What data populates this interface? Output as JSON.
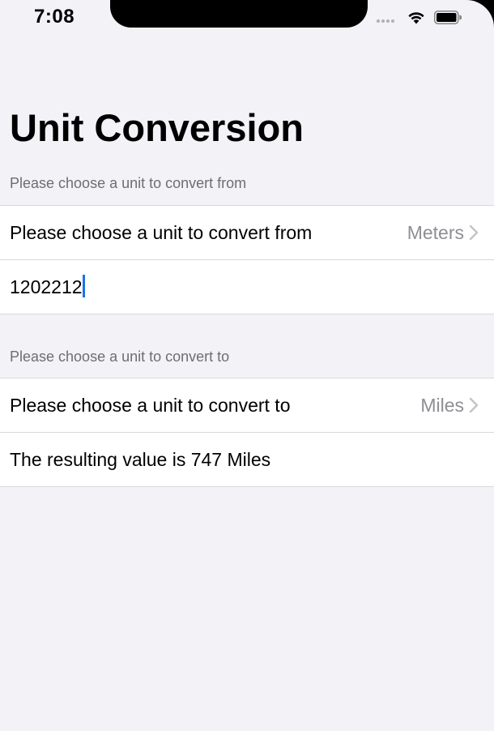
{
  "status_bar": {
    "time": "7:08"
  },
  "page": {
    "title": "Unit Conversion"
  },
  "from_section": {
    "header": "Please choose a unit to convert from",
    "picker_label": "Please choose a unit to convert from",
    "picker_value": "Meters",
    "input_value": "1202212"
  },
  "to_section": {
    "header": "Please choose a unit to convert to",
    "picker_label": "Please choose a unit to convert to",
    "picker_value": "Miles",
    "result_text": "The resulting value is 747 Miles"
  },
  "icons": {
    "wifi": "wifi-icon",
    "battery": "battery-icon",
    "signal": "signal-dots-icon",
    "chevron": "chevron-right-icon"
  },
  "colors": {
    "background": "#f2f2f7",
    "secondary_text": "#8e8e93",
    "caret": "#1a73e8"
  }
}
